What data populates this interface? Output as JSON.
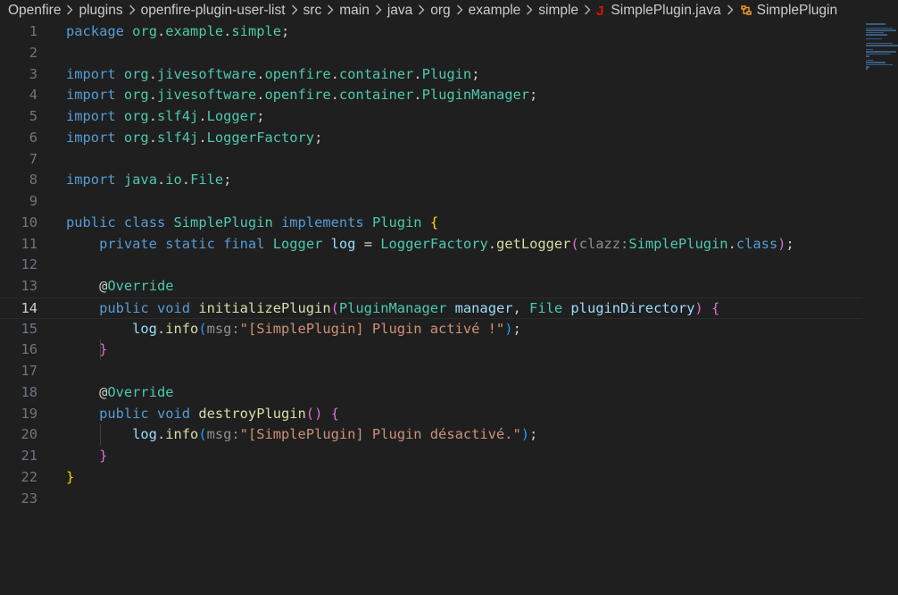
{
  "breadcrumb": {
    "items": [
      "Openfire",
      "plugins",
      "openfire-plugin-user-list",
      "src",
      "main",
      "java",
      "org",
      "example",
      "simple"
    ],
    "file": "SimplePlugin.java",
    "file_icon": "J",
    "symbol": "SimplePlugin"
  },
  "editor": {
    "active_line": 14,
    "line_numbers": [
      "1",
      "2",
      "3",
      "4",
      "5",
      "6",
      "7",
      "8",
      "9",
      "10",
      "11",
      "12",
      "13",
      "14",
      "15",
      "16",
      "17",
      "18",
      "19",
      "20",
      "21",
      "22",
      "23"
    ],
    "lines": [
      [
        {
          "t": "kw",
          "v": "package"
        },
        {
          "t": "p",
          "v": " "
        },
        {
          "t": "ns",
          "v": "org"
        },
        {
          "t": "p",
          "v": "."
        },
        {
          "t": "ns",
          "v": "example"
        },
        {
          "t": "p",
          "v": "."
        },
        {
          "t": "ns",
          "v": "simple"
        },
        {
          "t": "p",
          "v": ";"
        }
      ],
      [],
      [
        {
          "t": "kw",
          "v": "import"
        },
        {
          "t": "p",
          "v": " "
        },
        {
          "t": "ns",
          "v": "org"
        },
        {
          "t": "p",
          "v": "."
        },
        {
          "t": "ns",
          "v": "jivesoftware"
        },
        {
          "t": "p",
          "v": "."
        },
        {
          "t": "ns",
          "v": "openfire"
        },
        {
          "t": "p",
          "v": "."
        },
        {
          "t": "ns",
          "v": "container"
        },
        {
          "t": "p",
          "v": "."
        },
        {
          "t": "ty",
          "v": "Plugin"
        },
        {
          "t": "p",
          "v": ";"
        }
      ],
      [
        {
          "t": "kw",
          "v": "import"
        },
        {
          "t": "p",
          "v": " "
        },
        {
          "t": "ns",
          "v": "org"
        },
        {
          "t": "p",
          "v": "."
        },
        {
          "t": "ns",
          "v": "jivesoftware"
        },
        {
          "t": "p",
          "v": "."
        },
        {
          "t": "ns",
          "v": "openfire"
        },
        {
          "t": "p",
          "v": "."
        },
        {
          "t": "ns",
          "v": "container"
        },
        {
          "t": "p",
          "v": "."
        },
        {
          "t": "ty",
          "v": "PluginManager"
        },
        {
          "t": "p",
          "v": ";"
        }
      ],
      [
        {
          "t": "kw",
          "v": "import"
        },
        {
          "t": "p",
          "v": " "
        },
        {
          "t": "ns",
          "v": "org"
        },
        {
          "t": "p",
          "v": "."
        },
        {
          "t": "ns",
          "v": "slf4j"
        },
        {
          "t": "p",
          "v": "."
        },
        {
          "t": "ty",
          "v": "Logger"
        },
        {
          "t": "p",
          "v": ";"
        }
      ],
      [
        {
          "t": "kw",
          "v": "import"
        },
        {
          "t": "p",
          "v": " "
        },
        {
          "t": "ns",
          "v": "org"
        },
        {
          "t": "p",
          "v": "."
        },
        {
          "t": "ns",
          "v": "slf4j"
        },
        {
          "t": "p",
          "v": "."
        },
        {
          "t": "ty",
          "v": "LoggerFactory"
        },
        {
          "t": "p",
          "v": ";"
        }
      ],
      [],
      [
        {
          "t": "kw",
          "v": "import"
        },
        {
          "t": "p",
          "v": " "
        },
        {
          "t": "ns",
          "v": "java"
        },
        {
          "t": "p",
          "v": "."
        },
        {
          "t": "ns",
          "v": "io"
        },
        {
          "t": "p",
          "v": "."
        },
        {
          "t": "ty",
          "v": "File"
        },
        {
          "t": "p",
          "v": ";"
        }
      ],
      [],
      [
        {
          "t": "kw",
          "v": "public"
        },
        {
          "t": "p",
          "v": " "
        },
        {
          "t": "kw",
          "v": "class"
        },
        {
          "t": "p",
          "v": " "
        },
        {
          "t": "ty",
          "v": "SimplePlugin"
        },
        {
          "t": "p",
          "v": " "
        },
        {
          "t": "kw",
          "v": "implements"
        },
        {
          "t": "p",
          "v": " "
        },
        {
          "t": "ty",
          "v": "Plugin"
        },
        {
          "t": "p",
          "v": " "
        },
        {
          "t": "b1",
          "v": "{"
        }
      ],
      [
        {
          "t": "p",
          "v": "    "
        },
        {
          "t": "kw",
          "v": "private"
        },
        {
          "t": "p",
          "v": " "
        },
        {
          "t": "kw",
          "v": "static"
        },
        {
          "t": "p",
          "v": " "
        },
        {
          "t": "kw",
          "v": "final"
        },
        {
          "t": "p",
          "v": " "
        },
        {
          "t": "ty",
          "v": "Logger"
        },
        {
          "t": "p",
          "v": " "
        },
        {
          "t": "var",
          "v": "log"
        },
        {
          "t": "p",
          "v": " = "
        },
        {
          "t": "ty",
          "v": "LoggerFactory"
        },
        {
          "t": "p",
          "v": "."
        },
        {
          "t": "fn",
          "v": "getLogger"
        },
        {
          "t": "b2",
          "v": "("
        },
        {
          "t": "hint",
          "v": "clazz:"
        },
        {
          "t": "ty",
          "v": "SimplePlugin"
        },
        {
          "t": "p",
          "v": "."
        },
        {
          "t": "kw",
          "v": "class"
        },
        {
          "t": "b2",
          "v": ")"
        },
        {
          "t": "p",
          "v": ";"
        }
      ],
      [],
      [
        {
          "t": "p",
          "v": "    "
        },
        {
          "t": "p",
          "v": "@"
        },
        {
          "t": "ty",
          "v": "Override"
        }
      ],
      [
        {
          "t": "p",
          "v": "    "
        },
        {
          "t": "kw",
          "v": "public"
        },
        {
          "t": "p",
          "v": " "
        },
        {
          "t": "kw",
          "v": "void"
        },
        {
          "t": "p",
          "v": " "
        },
        {
          "t": "fn",
          "v": "initializePlugin"
        },
        {
          "t": "b2",
          "v": "("
        },
        {
          "t": "ty",
          "v": "PluginManager"
        },
        {
          "t": "p",
          "v": " "
        },
        {
          "t": "var",
          "v": "manager"
        },
        {
          "t": "p",
          "v": ", "
        },
        {
          "t": "ty",
          "v": "File"
        },
        {
          "t": "p",
          "v": " "
        },
        {
          "t": "var",
          "v": "pluginDirectory"
        },
        {
          "t": "b2",
          "v": ")"
        },
        {
          "t": "p",
          "v": " "
        },
        {
          "t": "b2",
          "v": "{"
        }
      ],
      [
        {
          "t": "p",
          "v": "        "
        },
        {
          "t": "var",
          "v": "log"
        },
        {
          "t": "p",
          "v": "."
        },
        {
          "t": "fn",
          "v": "info"
        },
        {
          "t": "b3",
          "v": "("
        },
        {
          "t": "hint",
          "v": "msg:"
        },
        {
          "t": "str",
          "v": "\"[SimplePlugin] Plugin activé !\""
        },
        {
          "t": "b3",
          "v": ")"
        },
        {
          "t": "p",
          "v": ";"
        }
      ],
      [
        {
          "t": "p",
          "v": "    "
        },
        {
          "t": "b2",
          "v": "}"
        }
      ],
      [],
      [
        {
          "t": "p",
          "v": "    "
        },
        {
          "t": "p",
          "v": "@"
        },
        {
          "t": "ty",
          "v": "Override"
        }
      ],
      [
        {
          "t": "p",
          "v": "    "
        },
        {
          "t": "kw",
          "v": "public"
        },
        {
          "t": "p",
          "v": " "
        },
        {
          "t": "kw",
          "v": "void"
        },
        {
          "t": "p",
          "v": " "
        },
        {
          "t": "fn",
          "v": "destroyPlugin"
        },
        {
          "t": "b2",
          "v": "()"
        },
        {
          "t": "p",
          "v": " "
        },
        {
          "t": "b2",
          "v": "{"
        }
      ],
      [
        {
          "t": "p",
          "v": "        "
        },
        {
          "t": "var",
          "v": "log"
        },
        {
          "t": "p",
          "v": "."
        },
        {
          "t": "fn",
          "v": "info"
        },
        {
          "t": "b3",
          "v": "("
        },
        {
          "t": "hint",
          "v": "msg:"
        },
        {
          "t": "str",
          "v": "\"[SimplePlugin] Plugin désactivé.\""
        },
        {
          "t": "b3",
          "v": ")"
        },
        {
          "t": "p",
          "v": ";"
        }
      ],
      [
        {
          "t": "p",
          "v": "    "
        },
        {
          "t": "b2",
          "v": "}"
        }
      ],
      [
        {
          "t": "b1",
          "v": "}"
        }
      ],
      []
    ]
  }
}
